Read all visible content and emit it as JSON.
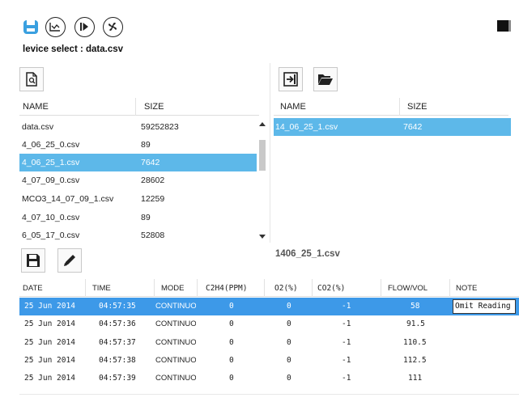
{
  "toolbar": {
    "icons": [
      "save-disk-icon",
      "chart-icon",
      "play-step-icon",
      "fan-icon"
    ]
  },
  "device_select_label": "levice select : data.csv",
  "left_panel": {
    "columns": [
      "NAME",
      "SIZE"
    ],
    "rows": [
      {
        "name": "data.csv",
        "size": "59252823"
      },
      {
        "name": "4_06_25_0.csv",
        "size": "89"
      },
      {
        "name": "4_06_25_1.csv",
        "size": "7642"
      },
      {
        "name": "4_07_09_0.csv",
        "size": "28602"
      },
      {
        "name": "MCO3_14_07_09_1.csv",
        "size": "12259"
      },
      {
        "name": "4_07_10_0.csv",
        "size": "89"
      },
      {
        "name": "6_05_17_0.csv",
        "size": "52808"
      }
    ],
    "selected_index": 2
  },
  "right_panel": {
    "columns": [
      "NAME",
      "SIZE"
    ],
    "rows": [
      {
        "name": "14_06_25_1.csv",
        "size": "7642"
      }
    ],
    "selected_index": 0
  },
  "current_file_label": "1406_25_1.csv",
  "data_table": {
    "columns": [
      "DATE",
      "TIME",
      "MODE",
      "C2H4(PPM)",
      "O2(%)",
      "CO2(%)",
      "FLOW/VOL",
      "NOTE"
    ],
    "rows": [
      {
        "date": "25 Jun 2014",
        "time": "04:57:35",
        "mode": "CONTINUOU",
        "c2h4": "0",
        "o2": "0",
        "co2": "-1",
        "flow": "58",
        "note": "Omit Reading"
      },
      {
        "date": "25 Jun 2014",
        "time": "04:57:36",
        "mode": "CONTINUOU",
        "c2h4": "0",
        "o2": "0",
        "co2": "-1",
        "flow": "91.5",
        "note": ""
      },
      {
        "date": "25 Jun 2014",
        "time": "04:57:37",
        "mode": "CONTINUOU",
        "c2h4": "0",
        "o2": "0",
        "co2": "-1",
        "flow": "110.5",
        "note": ""
      },
      {
        "date": "25 Jun 2014",
        "time": "04:57:38",
        "mode": "CONTINUOU",
        "c2h4": "0",
        "o2": "0",
        "co2": "-1",
        "flow": "112.5",
        "note": ""
      },
      {
        "date": "25 Jun 2014",
        "time": "04:57:39",
        "mode": "CONTINUOU",
        "c2h4": "0",
        "o2": "0",
        "co2": "-1",
        "flow": "111",
        "note": ""
      }
    ],
    "selected_index": 0
  },
  "colors": {
    "file_selection": "#5db8e9",
    "row_selection": "#3d99e8"
  }
}
